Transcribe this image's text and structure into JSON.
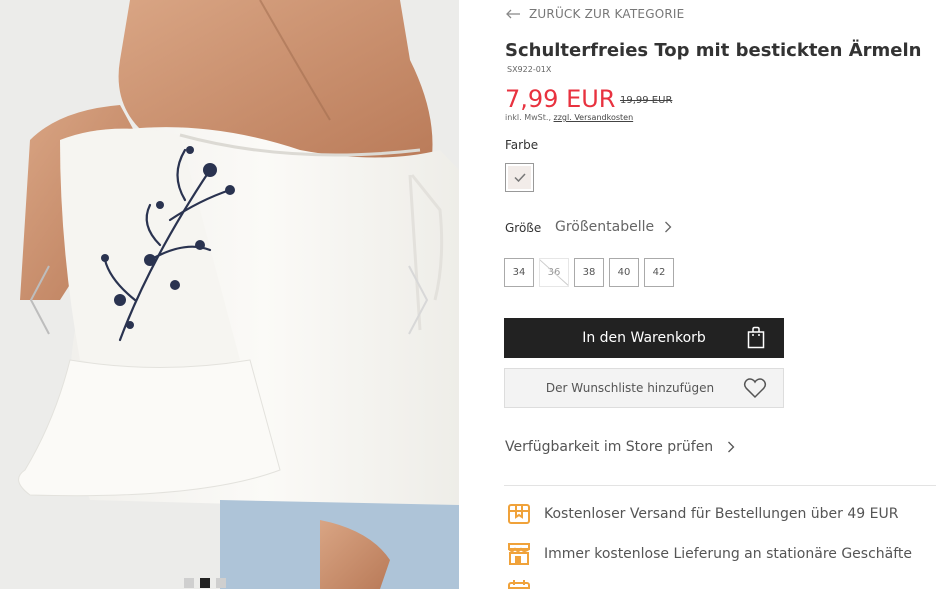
{
  "gallery": {
    "dots": [
      {
        "active": false
      },
      {
        "active": true
      },
      {
        "active": false
      }
    ]
  },
  "product": {
    "back_label": "ZURÜCK ZUR KATEGORIE",
    "title": "Schulterfreies Top mit bestickten Ärmeln",
    "sku": "SX922-01X",
    "price": "7,99 EUR",
    "old_price": "19,99 EUR",
    "tax_prefix": "inkl. MwSt.,",
    "shipping_link": "zzgl. Versandkosten",
    "color_label": "Farbe",
    "size_label": "Größe",
    "size_table_label": "Größentabelle",
    "sizes": [
      {
        "label": "34",
        "available": true
      },
      {
        "label": "36",
        "available": false
      },
      {
        "label": "38",
        "available": true
      },
      {
        "label": "40",
        "available": true
      },
      {
        "label": "42",
        "available": true
      }
    ],
    "cart_label": "In den Warenkorb",
    "wishlist_label": "Der Wunschliste hinzufügen",
    "availability_label": "Verfügbarkeit im Store prüfen"
  },
  "benefits": [
    {
      "icon": "delivery-box-icon",
      "text": "Kostenloser Versand für Bestellungen über 49 EUR"
    },
    {
      "icon": "store-icon",
      "text": "Immer kostenlose Lieferung an stationäre Geschäfte"
    }
  ],
  "colors": {
    "price_red": "#e8323f",
    "button_dark": "#222222",
    "icon_orange": "#f0a23a",
    "swatch": "#f2ece9"
  }
}
